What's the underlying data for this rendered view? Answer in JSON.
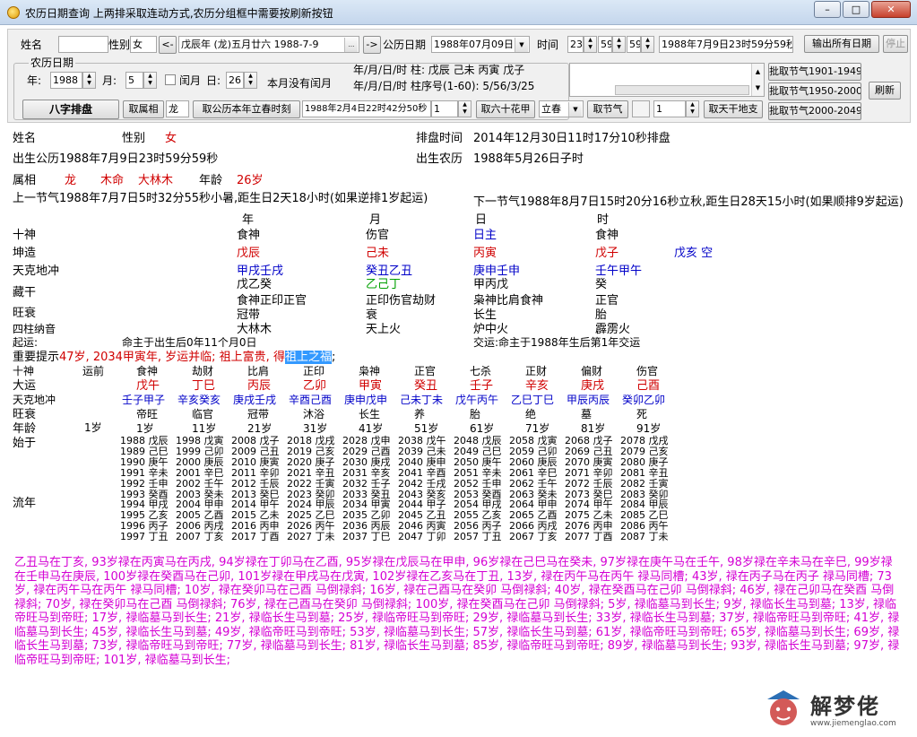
{
  "window": {
    "title": "农历日期查询 上两排采取连动方式,农历分组框中需要按刷新按钮",
    "close": "✕",
    "max": "□",
    "min": "–"
  },
  "toolbar": {
    "name_label": "姓名",
    "name_value": "",
    "gender_label": "性别",
    "gender_value": "女",
    "prev": "<-",
    "lunar_combo": "戊辰年 (龙)五月廿六 1988-7-9",
    "ellipsis": "...",
    "next": "->",
    "solar_label": "公历日期",
    "solar_value": "1988年07月09日",
    "time_label": "时间",
    "hour": "23",
    "minute": "59",
    "second": "59",
    "datetime_display": "1988年7月9日23时59分59秒",
    "output_all": "输出所有日期",
    "stop": "停止",
    "group_title": "农历日期",
    "year_label": "年:",
    "year_value": "1988",
    "month_label": "月:",
    "month_value": "5",
    "leap_label": "闰月",
    "day_label": "日:",
    "day_value": "26",
    "no_leap_text": "本月没有闰月",
    "info1": "年/月/日/时 柱: 戊辰 己未 丙寅 戊子",
    "info2": "年/月/日/时 柱序号(1-60): 5/56/3/25",
    "batch1": "批取节气1901-1949",
    "batch2": "批取节气1950-2000",
    "refresh": "刷新",
    "batch3": "批取节气2000-2049",
    "bazi_btn": "八字排盘",
    "get_zodiac": "取属相",
    "zodiac_value": "龙",
    "get_lichun": "取公历本年立春时刻",
    "lichun_value": "1988年2月4日22时42分50秒",
    "jiazi_value": "1",
    "jiazi_btn": "取六十花甲",
    "jieqi_select": "立春",
    "jieqi_btn": "取节气",
    "ganzhi_value": "1",
    "ganzhi_btn": "取天干地支"
  },
  "result": {
    "name_label": "姓名",
    "gender_label": "性别",
    "gender": "女",
    "pan_time_label": "排盘时间",
    "pan_time": "2014年12月30日11时17分10秒排盘",
    "birth_solar": "出生公历1988年7月9日23时59分59秒",
    "birth_lunar_label": "出生农历",
    "birth_lunar": "1988年5月26日子时",
    "zodiac_label": "属相",
    "zodiac": "龙",
    "ming": "木命",
    "nayin": "大林木",
    "age_label": "年龄",
    "age": "26岁",
    "prev_jieqi": "上一节气1988年7月7日5时32分55秒小暑,距生日2天18小时(如果逆排1岁起运)",
    "next_jieqi": "下一节气1988年8月7日15时20分16秒立秋,距生日28天15小时(如果顺排9岁起运)",
    "row_labels": [
      "十神",
      "坤造",
      "天克地冲",
      "藏干",
      "旺衰",
      "四柱纳音"
    ],
    "pillar_headers": [
      "年",
      "月",
      "日",
      "时"
    ],
    "shishen": [
      "食神",
      "伤官",
      "日主",
      "食神"
    ],
    "ganzhi": [
      "戊辰",
      "己未",
      "丙寅",
      "戊子"
    ],
    "kong": "戊亥 空",
    "kechong": [
      "甲戌壬戌",
      "癸丑乙丑",
      "庚申壬申",
      "壬午甲午"
    ],
    "canggan": [
      "戊乙癸",
      "乙己丁",
      "甲丙戊",
      "癸"
    ],
    "canggan_shishen": [
      "食神正印正官",
      "正印伤官劫财",
      "枭神比肩食神",
      "正官"
    ],
    "wangshuai": [
      "冠带",
      "衰",
      "长生",
      "胎"
    ],
    "nayin_list": [
      "大林木",
      "天上火",
      "炉中火",
      "霹雳火"
    ],
    "qiyun_label": "起运:",
    "qiyun": "命主于出生后0年11个月0日",
    "jiaoyun": "交运:命主于1988年生后第1年交运",
    "hint_prefix": "重要提示",
    "hint_red": "47岁, 2034甲寅年, 岁运并临; 祖上富贵, 得",
    "hint_sel": "祖上之福",
    "hint_end": ";",
    "dy_labels": [
      "十神",
      "大运",
      "天克地冲",
      "旺衰",
      "年龄",
      "始于",
      "流年"
    ],
    "dy_first": "运前",
    "dy_first_age": "1岁",
    "dayun": [
      {
        "ss": "食神",
        "gz": "戊午",
        "kc": "壬子甲子",
        "ws": "帝旺",
        "age": "1岁"
      },
      {
        "ss": "劫财",
        "gz": "丁巳",
        "kc": "辛亥癸亥",
        "ws": "临官",
        "age": "11岁"
      },
      {
        "ss": "比肩",
        "gz": "丙辰",
        "kc": "庚戌壬戌",
        "ws": "冠带",
        "age": "21岁"
      },
      {
        "ss": "正印",
        "gz": "乙卯",
        "kc": "辛酉己酉",
        "ws": "沐浴",
        "age": "31岁"
      },
      {
        "ss": "枭神",
        "gz": "甲寅",
        "kc": "庚申戊申",
        "ws": "长生",
        "age": "41岁"
      },
      {
        "ss": "正官",
        "gz": "癸丑",
        "kc": "己未丁未",
        "ws": "养",
        "age": "51岁"
      },
      {
        "ss": "七杀",
        "gz": "壬子",
        "kc": "戊午丙午",
        "ws": "胎",
        "age": "61岁"
      },
      {
        "ss": "正财",
        "gz": "辛亥",
        "kc": "乙巳丁巳",
        "ws": "绝",
        "age": "71岁"
      },
      {
        "ss": "偏财",
        "gz": "庚戌",
        "kc": "甲辰丙辰",
        "ws": "墓",
        "age": "81岁"
      },
      {
        "ss": "伤官",
        "gz": "己酉",
        "kc": "癸卯乙卯",
        "ws": "死",
        "age": "91岁"
      }
    ],
    "liunian": [
      "1988 戊辰\n1989 己巳\n1990 庚午\n1991 辛未\n1992 壬申\n1993 癸酉\n1994 甲戌\n1995 乙亥\n1996 丙子\n1997 丁丑",
      "1998 戊寅\n1999 己卯\n2000 庚辰\n2001 辛巳\n2002 壬午\n2003 癸未\n2004 甲申\n2005 乙酉\n2006 丙戌\n2007 丁亥",
      "2008 戊子\n2009 己丑\n2010 庚寅\n2011 辛卯\n2012 壬辰\n2013 癸巳\n2014 甲午\n2015 乙未\n2016 丙申\n2017 丁酉",
      "2018 戊戌\n2019 己亥\n2020 庚子\n2021 辛丑\n2022 壬寅\n2023 癸卯\n2024 甲辰\n2025 乙巳\n2026 丙午\n2027 丁未",
      "2028 戊申\n2029 己酉\n2030 庚戌\n2031 辛亥\n2032 壬子\n2033 癸丑\n2034 甲寅\n2035 乙卯\n2036 丙辰\n2037 丁巳",
      "2038 戊午\n2039 己未\n2040 庚申\n2041 辛酉\n2042 壬戌\n2043 癸亥\n2044 甲子\n2045 乙丑\n2046 丙寅\n2047 丁卯",
      "2048 戊辰\n2049 己巳\n2050 庚午\n2051 辛未\n2052 壬申\n2053 癸酉\n2054 甲戌\n2055 乙亥\n2056 丙子\n2057 丁丑",
      "2058 戊寅\n2059 己卯\n2060 庚辰\n2061 辛巳\n2062 壬午\n2063 癸未\n2064 甲申\n2065 乙酉\n2066 丙戌\n2067 丁亥",
      "2068 戊子\n2069 己丑\n2070 庚寅\n2071 辛卯\n2072 壬辰\n2073 癸巳\n2074 甲午\n2075 乙未\n2076 丙申\n2077 丁酉",
      "2078 戊戌\n2079 己亥\n2080 庚子\n2081 辛丑\n2082 壬寅\n2083 癸卯\n2084 甲辰\n2085 乙巳\n2086 丙午\n2087 丁未"
    ]
  },
  "bottom_text": "乙丑马在丁亥, 93岁禄在丙寅马在丙戌, 94岁禄在丁卯马在乙酉, 95岁禄在戊辰马在甲申, 96岁禄在己巳马在癸未, 97岁禄在庚午马在壬午, 98岁禄在辛未马在辛巳, 99岁禄在壬申马在庚辰, 100岁禄在癸酉马在己卯, 101岁禄在甲戌马在戊寅, 102岁禄在乙亥马在丁丑, 13岁, 禄在丙午马在丙午 禄马同槽; 43岁, 禄在丙子马在丙子 禄马同槽; 73岁, 禄在丙午马在丙午 禄马同槽; 10岁, 禄在癸卯马在己酉 马倒禄斜; 16岁, 禄在己酉马在癸卯 马倒禄斜; 40岁, 禄在癸酉马在己卯 马倒禄斜; 46岁, 禄在己卯马在癸酉 马倒禄斜; 70岁, 禄在癸卯马在己酉 马倒禄斜; 76岁, 禄在己酉马在癸卯 马倒禄斜; 100岁, 禄在癸酉马在己卯 马倒禄斜; 5岁, 禄临墓马到长生; 9岁, 禄临长生马到墓; 13岁, 禄临帝旺马到帝旺; 17岁, 禄临墓马到长生; 21岁, 禄临长生马到墓; 25岁, 禄临帝旺马到帝旺; 29岁, 禄临墓马到长生; 33岁, 禄临长生马到墓; 37岁, 禄临帝旺马到帝旺; 41岁, 禄临墓马到长生; 45岁, 禄临长生马到墓; 49岁, 禄临帝旺马到帝旺; 53岁, 禄临墓马到长生; 57岁, 禄临长生马到墓; 61岁, 禄临帝旺马到帝旺; 65岁, 禄临墓马到长生; 69岁, 禄临长生马到墓; 73岁, 禄临帝旺马到帝旺; 77岁, 禄临墓马到长生; 81岁, 禄临长生马到墓; 85岁, 禄临帝旺马到帝旺; 89岁, 禄临墓马到长生; 93岁, 禄临长生马到墓; 97岁, 禄临帝旺马到帝旺; 101岁, 禄临墓马到长生;",
  "logo": {
    "text": "解梦佬",
    "url": "www.jiemenglao.com"
  }
}
